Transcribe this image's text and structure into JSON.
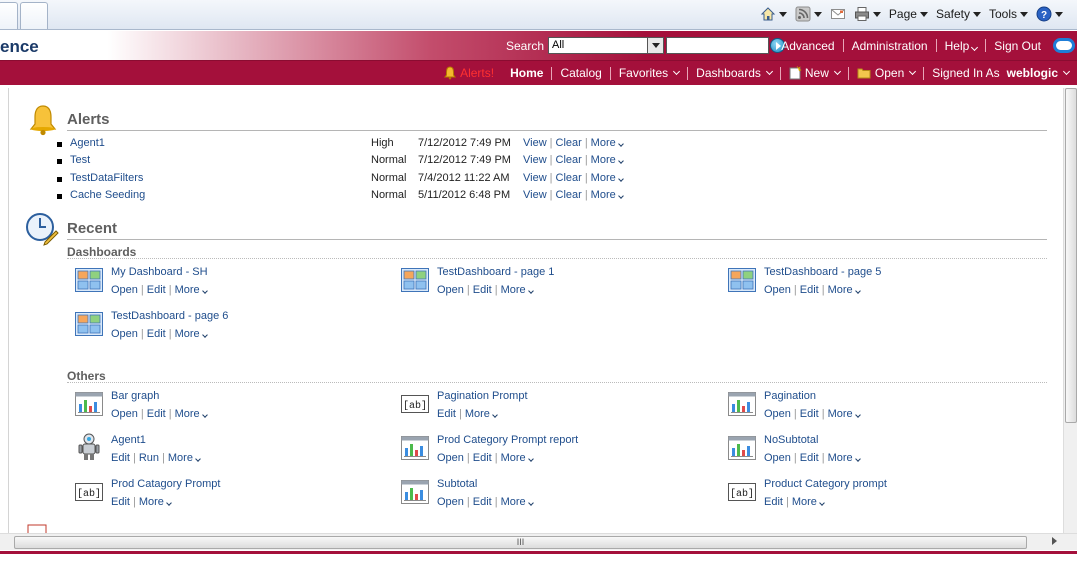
{
  "browser": {
    "tools": [
      {
        "id": "home",
        "icon": "home-icon",
        "label": ""
      },
      {
        "id": "feeds",
        "icon": "rss-icon",
        "label": ""
      },
      {
        "id": "mail",
        "icon": "mail-icon",
        "label": ""
      },
      {
        "id": "print",
        "icon": "print-icon",
        "label": ""
      },
      {
        "id": "page",
        "label": "Page"
      },
      {
        "id": "safety",
        "label": "Safety"
      },
      {
        "id": "tools",
        "label": "Tools"
      },
      {
        "id": "help",
        "icon": "help-icon",
        "label": ""
      }
    ]
  },
  "header": {
    "brand": "ence",
    "search_label": "Search",
    "search_scope": "All",
    "search_value": "",
    "links": [
      "Advanced",
      "Administration",
      "Help",
      "Sign Out"
    ]
  },
  "nav": {
    "alerts": "Alerts!",
    "home": "Home",
    "catalog": "Catalog",
    "favorites": "Favorites",
    "dashboards": "Dashboards",
    "new": "New",
    "open": "Open",
    "signed_in_as": "Signed In As",
    "user": "weblogic"
  },
  "alerts": {
    "title": "Alerts",
    "rows": [
      {
        "name": "Agent1",
        "priority": "High",
        "date": "7/12/2012 7:49 PM"
      },
      {
        "name": "Test",
        "priority": "Normal",
        "date": "7/12/2012 7:49 PM"
      },
      {
        "name": "TestDataFilters",
        "priority": "Normal",
        "date": "7/4/2012 11:22 AM"
      },
      {
        "name": "Cache Seeding",
        "priority": "Normal",
        "date": "5/11/2012 6:48 PM"
      }
    ],
    "actions": {
      "view": "View",
      "clear": "Clear",
      "more": "More"
    }
  },
  "recent": {
    "title": "Recent",
    "dashboards_label": "Dashboards",
    "others_label": "Others",
    "dashboards": [
      {
        "title": "My Dashboard - SH",
        "actions": [
          "Open",
          "Edit",
          "More"
        ]
      },
      {
        "title": "TestDashboard - page 1",
        "actions": [
          "Open",
          "Edit",
          "More"
        ]
      },
      {
        "title": "TestDashboard - page 5",
        "actions": [
          "Open",
          "Edit",
          "More"
        ]
      },
      {
        "title": "TestDashboard - page 6",
        "actions": [
          "Open",
          "Edit",
          "More"
        ]
      }
    ],
    "others": [
      {
        "title": "Bar graph",
        "icon": "analysis-icon",
        "actions": [
          "Open",
          "Edit",
          "More"
        ]
      },
      {
        "title": "Pagination Prompt",
        "icon": "prompt-icon",
        "actions": [
          "Edit",
          "More"
        ]
      },
      {
        "title": "Pagination",
        "icon": "analysis-icon",
        "actions": [
          "Open",
          "Edit",
          "More"
        ]
      },
      {
        "title": "Agent1",
        "icon": "agent-icon",
        "actions": [
          "Edit",
          "Run",
          "More"
        ]
      },
      {
        "title": "Prod Category Prompt report",
        "icon": "analysis-icon",
        "actions": [
          "Open",
          "Edit",
          "More"
        ]
      },
      {
        "title": "NoSubtotal",
        "icon": "analysis-icon",
        "actions": [
          "Open",
          "Edit",
          "More"
        ]
      },
      {
        "title": "Prod Catagory Prompt",
        "icon": "prompt-icon",
        "actions": [
          "Edit",
          "More"
        ]
      },
      {
        "title": "Subtotal",
        "icon": "analysis-icon",
        "actions": [
          "Open",
          "Edit",
          "More"
        ]
      },
      {
        "title": "Product Category prompt",
        "icon": "prompt-icon",
        "actions": [
          "Edit",
          "More"
        ]
      }
    ],
    "prompt_icon_text": "[ab]"
  },
  "scrollbar": {
    "grip": "III"
  },
  "colors": {
    "brand_red": "#a4103b",
    "link_blue": "#1f4d8c"
  }
}
